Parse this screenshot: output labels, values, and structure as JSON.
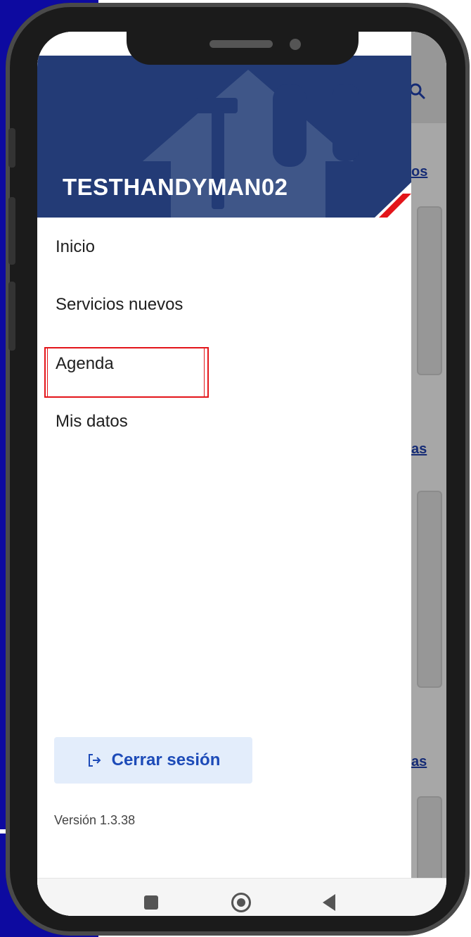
{
  "drawer": {
    "username": "TESTHANDYMAN02",
    "menu": [
      {
        "label": "Inicio"
      },
      {
        "label": "Servicios nuevos"
      },
      {
        "label": "Agenda"
      },
      {
        "label": "Mis datos"
      }
    ],
    "logout_label": "Cerrar sesión",
    "version": "Versión 1.3.38"
  },
  "background_app": {
    "links": [
      "os",
      "as",
      "as"
    ]
  },
  "colors": {
    "header_bg": "#233b76",
    "accent_red": "#e3151a",
    "logout_text": "#1d4bb8",
    "logout_bg": "#e3edfb",
    "frame_bg": "#0d0aa0"
  },
  "icons": {
    "logout": "logout-icon",
    "search": "search-icon",
    "nav_recents": "recents-icon",
    "nav_home": "home-icon",
    "nav_back": "back-icon"
  }
}
